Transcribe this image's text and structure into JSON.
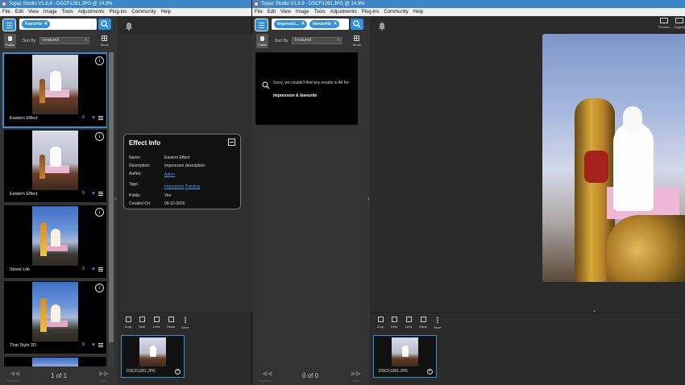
{
  "window": {
    "title": "Topaz Studio V1.6.9 - DSCF1281.JPG @ 14.9%",
    "menus": [
      "File",
      "Edit",
      "View",
      "Image",
      "Tools",
      "Adjustments",
      "Plug-ins",
      "Community",
      "Help"
    ]
  },
  "left": {
    "search_chips": [
      "Favorite"
    ],
    "public_label": "Public",
    "sort_label": "Sort By",
    "sort_value": "Featured",
    "small_label": "Small",
    "effects": [
      {
        "name": "Eastern Effect",
        "likes": "0"
      },
      {
        "name": "Eastern Effect",
        "likes": "0"
      },
      {
        "name": "Street Life",
        "likes": "0"
      },
      {
        "name": "Thai Style 2D",
        "likes": "0"
      }
    ],
    "pager_text": "1 of 1",
    "pager_prev": "Previous",
    "pager_next": "Next",
    "effect_info": {
      "title": "Effect Info",
      "rows": [
        {
          "label": "Name:",
          "value": "Eastern Effect"
        },
        {
          "label": "Description:",
          "value": "Impression description"
        },
        {
          "label": "Author:",
          "value": "Adion"
        },
        {
          "label": "Tags:",
          "value": "Impression",
          "value2": "Painting"
        },
        {
          "label": "Public:",
          "value": "Yes"
        },
        {
          "label": "Created On:",
          "value": "09-10-2016"
        }
      ]
    },
    "tools": [
      "Crop",
      "Heal",
      "Lens",
      "Mask",
      "More"
    ],
    "filmstrip_label": "DSCF1281.JPG"
  },
  "right": {
    "search_chips": [
      "Impressi...",
      "favourite"
    ],
    "public_label": "Public",
    "sort_label": "Sort By",
    "sort_value": "Featured",
    "small_label": "Small",
    "no_results_msg": "Sorry, we couldn't find any results in All for:",
    "no_results_query": "Impression & favourite",
    "pager_text": "0 of 0",
    "pager_prev": "Previous",
    "pager_next": "Next",
    "preview_label": "Preview",
    "original_label": "Original",
    "tools": [
      "Crop",
      "Heal",
      "Lens",
      "Mask",
      "More"
    ],
    "filmstrip_label": "DSCF1281.JPG"
  },
  "colors": {
    "accent": "#2f8fe0",
    "titlebar": "#3d86c6",
    "link": "#3e9be8"
  }
}
